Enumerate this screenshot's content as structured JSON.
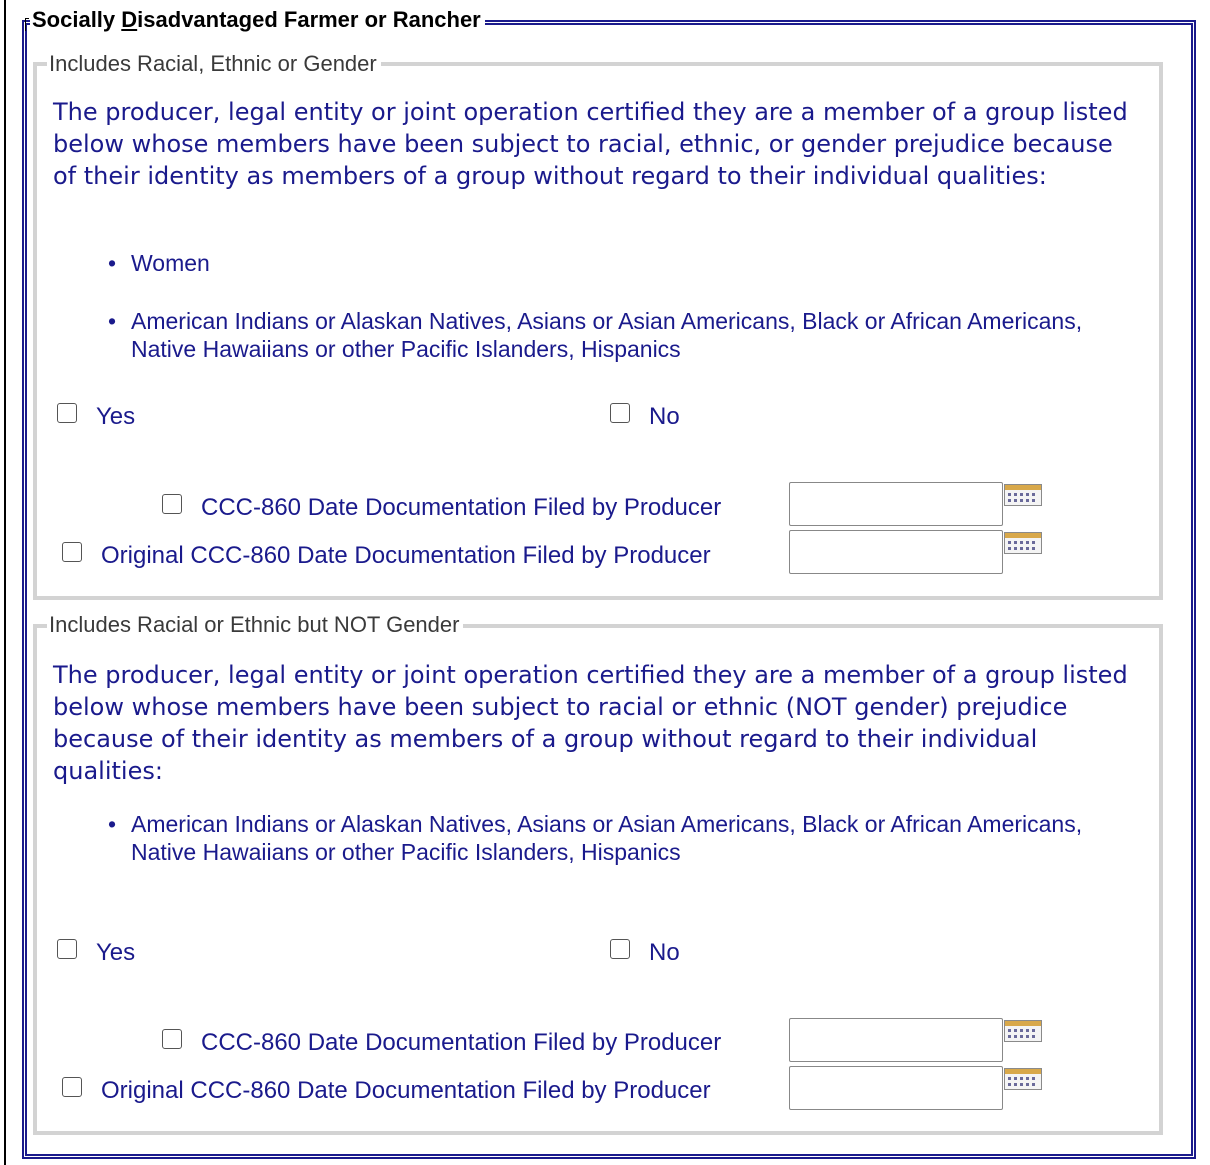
{
  "outer_section": {
    "legend_first_char": "Socially ",
    "legend_underlined": "D",
    "legend_rest": "isadvantaged Farmer or Rancher"
  },
  "section1": {
    "legend": "Includes Racial, Ethnic or Gender",
    "paragraph": "The producer, legal entity or joint operation certified they are a member of a group listed below whose members have been subject to racial, ethnic, or gender prejudice because of their identity as members of a group without regard to their individual qualities:",
    "bullets": [
      "Women",
      "American Indians or Alaskan Natives, Asians or Asian Americans, Black or African Americans, Native Hawaiians or other Pacific Islanders, Hispanics"
    ],
    "yes_label": "Yes",
    "no_label": "No",
    "yes_checked": false,
    "no_checked": false,
    "date_label": "CCC-860 Date Documentation Filed by Producer",
    "date_value": "",
    "date_checked": false,
    "original_date_label": "Original CCC-860 Date Documentation Filed by Producer",
    "original_date_value": "",
    "original_date_checked": false
  },
  "section2": {
    "legend": "Includes Racial or Ethnic but NOT Gender",
    "paragraph": "The producer, legal entity or joint operation certified they are a member of a group listed below whose members have been subject to racial or ethnic (NOT gender) prejudice because of their identity as members of a group without regard to their individual qualities:",
    "bullets": [
      "American Indians or Alaskan Natives, Asians or Asian Americans, Black or African Americans, Native Hawaiians or other Pacific Islanders, Hispanics"
    ],
    "yes_label": "Yes",
    "no_label": "No",
    "yes_checked": false,
    "no_checked": false,
    "date_label": "CCC-860 Date Documentation Filed by Producer",
    "date_value": "",
    "date_checked": false,
    "original_date_label": "Original CCC-860 Date Documentation Filed by Producer",
    "original_date_value": "",
    "original_date_checked": false
  },
  "icons": {
    "calendar": "calendar-icon"
  },
  "colors": {
    "text_blue": "#1a1a8c",
    "fieldset_grey": "#d3d3d3",
    "outer_border": "#1a1a8c"
  }
}
